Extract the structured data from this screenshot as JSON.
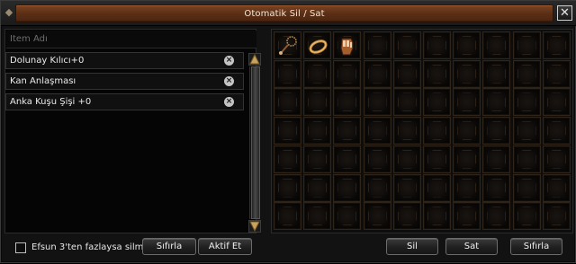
{
  "window": {
    "title": "Otomatik Sil / Sat",
    "close_glyph": "✕",
    "pin_glyph": "◆"
  },
  "search": {
    "placeholder": "İtem Adı",
    "value": ""
  },
  "items": [
    {
      "label": "Dolunay Kılıcı+0",
      "remove_icon": "remove-icon"
    },
    {
      "label": "Kan Anlaşması",
      "remove_icon": "remove-icon"
    },
    {
      "label": "Anka Kuşu Şişi +0",
      "remove_icon": "remove-icon"
    }
  ],
  "inventory": {
    "columns": 10,
    "rows": 7,
    "items": [
      {
        "column": 0,
        "row": 0,
        "icon": "rosary-icon"
      },
      {
        "column": 1,
        "row": 0,
        "icon": "ring-icon"
      },
      {
        "column": 2,
        "row": 0,
        "icon": "gauntlet-icon"
      }
    ]
  },
  "options": {
    "bonus_delete_label": "Efsun 3'ten fazlaysa silme",
    "bonus_delete_checked": false
  },
  "buttons": {
    "reset_list": "Sıfırla",
    "activate": "Aktif Et",
    "delete": "Sil",
    "sell": "Sat",
    "reset_inventory": "Sıfırla"
  },
  "colors": {
    "title_plate": "#5c2f15",
    "slot_border": "#2e241a",
    "background": "#121212"
  }
}
